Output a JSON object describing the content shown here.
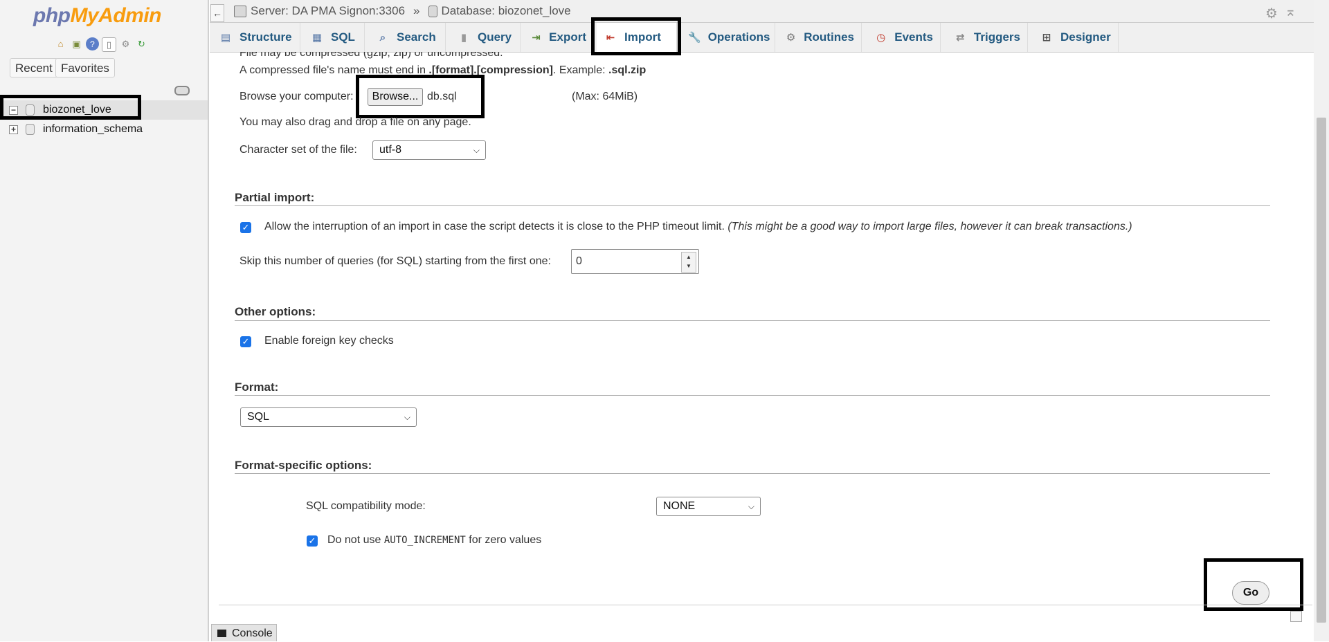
{
  "app": {
    "logo_php": "php",
    "logo_myadmin": "MyAdmin"
  },
  "sidebar": {
    "nav_icons": [
      "home-icon",
      "exit-icon",
      "help-icon",
      "docs-icon",
      "settings-icon",
      "reload-icon"
    ],
    "recent_label": "Recent",
    "favorites_label": "Favorites",
    "databases": [
      {
        "name": "biozonet_love",
        "expander": "−",
        "selected": true
      },
      {
        "name": "information_schema",
        "expander": "+",
        "selected": false
      }
    ]
  },
  "header": {
    "server_label": "Server: DA PMA Signon:3306",
    "separator": "»",
    "database_label": "Database: biozonet_love"
  },
  "tabs": [
    {
      "label": "Structure",
      "icon": "structure-icon"
    },
    {
      "label": "SQL",
      "icon": "sql-icon"
    },
    {
      "label": "Search",
      "icon": "search-icon"
    },
    {
      "label": "Query",
      "icon": "query-icon"
    },
    {
      "label": "Export",
      "icon": "export-icon"
    },
    {
      "label": "Import",
      "icon": "import-icon",
      "active": true
    },
    {
      "label": "Operations",
      "icon": "wrench-icon"
    },
    {
      "label": "Routines",
      "icon": "routines-icon"
    },
    {
      "label": "Events",
      "icon": "clock-icon"
    },
    {
      "label": "Triggers",
      "icon": "triggers-icon"
    },
    {
      "label": "Designer",
      "icon": "designer-icon"
    }
  ],
  "file_section": {
    "compressed_note_partial": "File may be compressed (gzip, zip) or uncompressed.",
    "compressed_name_prefix": "A compressed file's name must end in ",
    "compressed_name_format": ".[format].[compression]",
    "compressed_example_prefix": ". Example: ",
    "compressed_example": ".sql.zip",
    "browse_label": "Browse your computer:",
    "browse_button": "Browse...",
    "selected_file": "db.sql",
    "max_size": "(Max: 64MiB)",
    "drag_note": "You may also drag and drop a file on any page.",
    "charset_label": "Character set of the file:",
    "charset_value": "utf-8"
  },
  "partial_import": {
    "legend": "Partial import:",
    "allow_interrupt_label": "Allow the interruption of an import in case the script detects it is close to the PHP timeout limit.",
    "allow_interrupt_note": "(This might be a good way to import large files, however it can break transactions.)",
    "allow_interrupt_checked": true,
    "skip_label": "Skip this number of queries (for SQL) starting from the first one:",
    "skip_value": "0"
  },
  "other_options": {
    "legend": "Other options:",
    "fk_checks_label": "Enable foreign key checks",
    "fk_checks_checked": true
  },
  "format": {
    "legend": "Format:",
    "value": "SQL"
  },
  "format_specific": {
    "legend": "Format-specific options:",
    "compat_label": "SQL compatibility mode:",
    "compat_value": "NONE",
    "auto_inc_prefix": "Do not use ",
    "auto_inc_code": "AUTO_INCREMENT",
    "auto_inc_suffix": " for zero values",
    "auto_inc_checked": true
  },
  "actions": {
    "go_label": "Go"
  },
  "console": {
    "label": "Console"
  }
}
